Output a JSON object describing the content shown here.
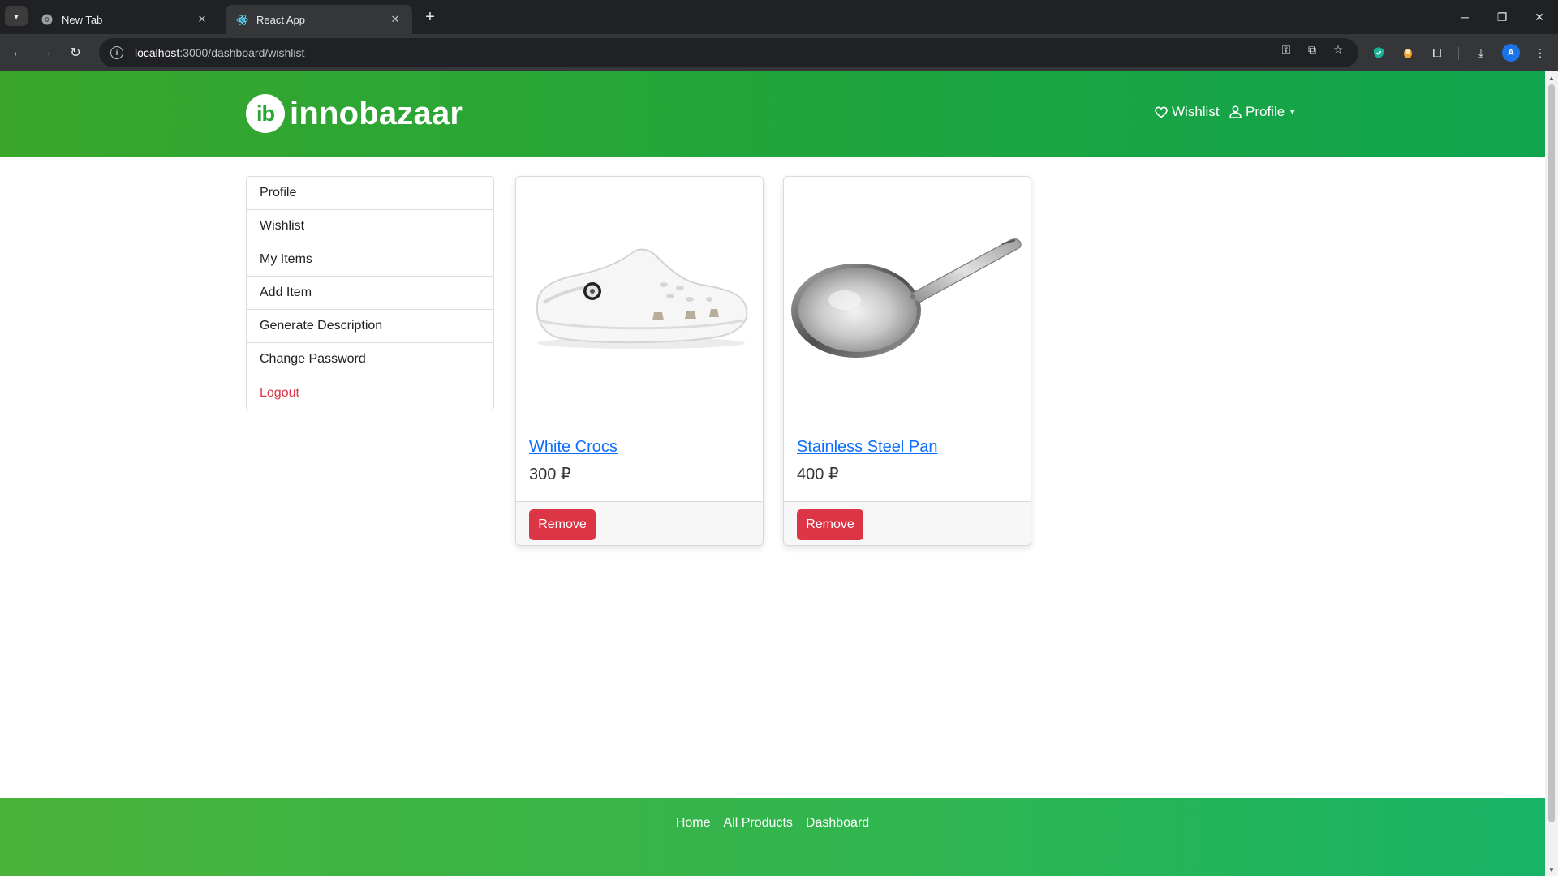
{
  "browser": {
    "tabs": [
      {
        "title": "New Tab",
        "active": false
      },
      {
        "title": "React App",
        "active": true
      }
    ],
    "url_host": "localhost",
    "url_path": ":3000/dashboard/wishlist"
  },
  "site": {
    "logo_text": "ib",
    "brand_name": "innobazaar",
    "nav": {
      "wishlist": "Wishlist",
      "profile": "Profile"
    },
    "colors": {
      "brand_green": "#27a834",
      "danger": "#dc3545",
      "link": "#0d6efd"
    }
  },
  "sidebar": {
    "items": [
      {
        "label": "Profile"
      },
      {
        "label": "Wishlist"
      },
      {
        "label": "My Items"
      },
      {
        "label": "Add Item"
      },
      {
        "label": "Generate Description"
      },
      {
        "label": "Change Password"
      },
      {
        "label": "Logout"
      }
    ]
  },
  "wishlist": {
    "items": [
      {
        "name": "White Crocs",
        "price": "300 ₽",
        "action": "Remove",
        "image": "white-clog-shoe"
      },
      {
        "name": "Stainless Steel Pan",
        "price": "400 ₽",
        "action": "Remove",
        "image": "frying-pan"
      }
    ]
  },
  "footer": {
    "links": [
      "Home",
      "All Products",
      "Dashboard"
    ]
  }
}
